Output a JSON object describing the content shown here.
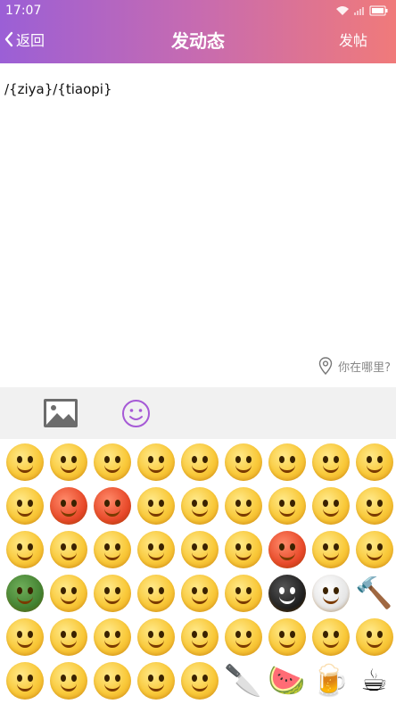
{
  "status_bar": {
    "time": "17:07",
    "icons": [
      "wifi-icon",
      "signal-icon",
      "battery-icon"
    ]
  },
  "header": {
    "back_label": "返回",
    "title": "发动态",
    "post_label": "发帖",
    "gradient": [
      "#9b5fd6",
      "#c76bb0",
      "#f07a7a"
    ]
  },
  "compose": {
    "text": "/{ziya}/{tiaopi}",
    "location_label": "你在哪里?"
  },
  "toolbar": {
    "icons": [
      "image-icon",
      "emoji-icon"
    ],
    "accent": "#a65ad6"
  },
  "emoji_panel": {
    "items": [
      "smile-emoji",
      "awkward-emoji",
      "heart-eyes-emoji",
      "shy-emoji",
      "cool-emoji",
      "crying-emoji",
      "blush-emoji",
      "dizzy-emoji",
      "wink-emoji",
      "laugh-cry-emoji",
      "angry-red-emoji",
      "furious-emoji",
      "tongue-emoji",
      "grin-emoji",
      "scared-emoji",
      "sad-emoji",
      "surprised-emoji",
      "yell-emoji",
      "confused-emoji",
      "cover-mouth-emoji",
      "happy-emoji",
      "stare-emoji",
      "pout-emoji",
      "dazed-emoji",
      "mad-emoji",
      "smirk-emoji",
      "big-grin-emoji",
      "turtle-emoji",
      "headband-emoji",
      "silly-emoji",
      "question-emoji",
      "shush-emoji",
      "dizzy-eyes-emoji",
      "bomb-emoji",
      "skull-emoji",
      "hammer-emoji",
      "think-emoji",
      "sweat-emoji",
      "sly-emoji",
      "blush-hide-emoji",
      "teeth-emoji",
      "peek-emoji",
      "yawn-emoji",
      "facepalm-emoji",
      "hug-emoji",
      "weary-emoji",
      "worried-emoji",
      "smug-emoji",
      "kiss-emoji",
      "shocked-emoji",
      "knife-emoji",
      "watermelon-emoji",
      "beer-emoji",
      "coffee-emoji"
    ]
  }
}
